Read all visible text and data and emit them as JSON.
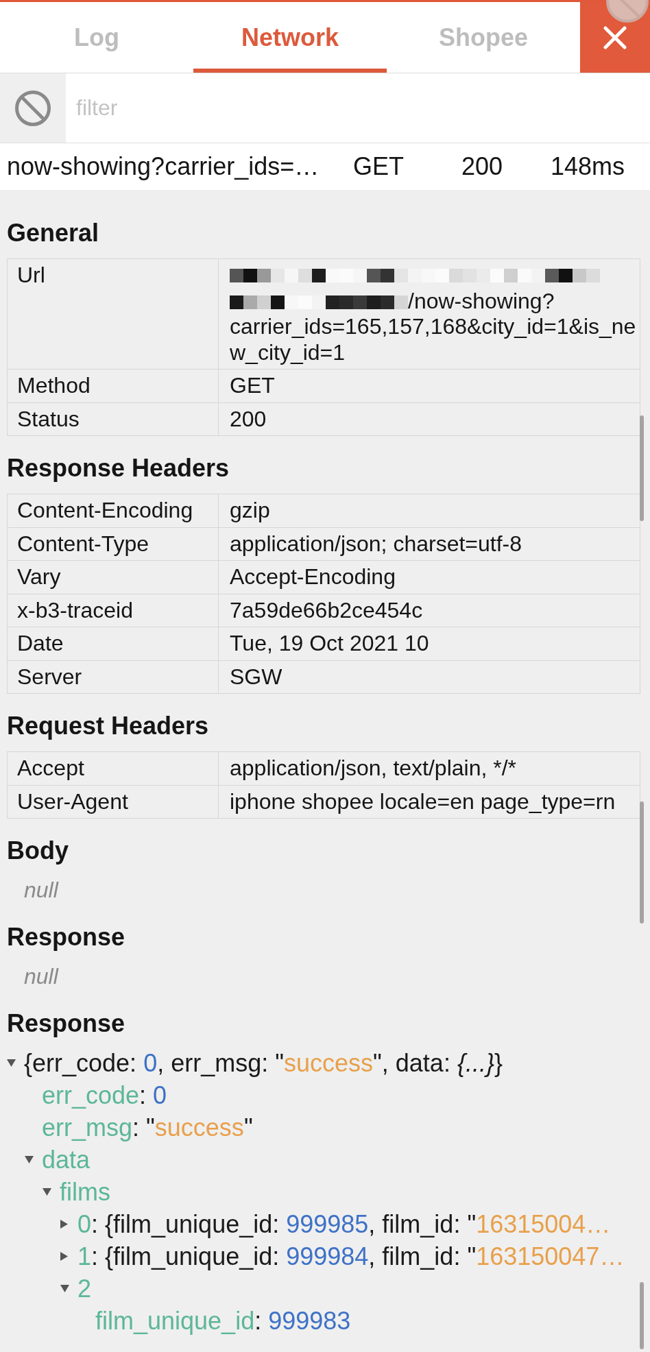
{
  "tabs": [
    {
      "label": "Log",
      "selected": false
    },
    {
      "label": "Network",
      "selected": true
    },
    {
      "label": "Shopee",
      "selected": false
    }
  ],
  "filter": {
    "placeholder": "filter"
  },
  "request": {
    "name": "now-showing?carrier_ids=…",
    "method": "GET",
    "status": "200",
    "time": "148ms"
  },
  "sections": [
    {
      "kind": "table",
      "title": "General",
      "rows": [
        {
          "name": "Url",
          "redacted": true,
          "visible_parts": [
            "/now-showing?",
            "carrier_ids=165,157,168&city_id=1&is_new_city_id=1"
          ]
        },
        {
          "name": "Method",
          "value": "GET",
          "redacted": false
        },
        {
          "name": "Status",
          "value": "200",
          "redacted": false
        }
      ]
    },
    {
      "kind": "table",
      "title": "Response Headers",
      "rows": [
        {
          "name": "Content-Encoding",
          "value": "gzip",
          "redacted": false
        },
        {
          "name": "Content-Type",
          "value": "application/json; charset=utf-8",
          "redacted": false
        },
        {
          "name": "Vary",
          "value": "Accept-Encoding",
          "redacted": false
        },
        {
          "name": "x-b3-traceid",
          "value": "7a59de66b2ce454c",
          "redacted": false
        },
        {
          "name": "Date",
          "value": "Tue, 19 Oct 2021 10",
          "redacted": false
        },
        {
          "name": "Server",
          "value": "SGW",
          "redacted": false
        }
      ]
    },
    {
      "kind": "table",
      "title": "Request Headers",
      "rows": [
        {
          "name": "Accept",
          "value": "application/json, text/plain, */*",
          "redacted": false
        },
        {
          "name": "User-Agent",
          "value": "iphone shopee locale=en page_type=rn",
          "redacted": false
        }
      ]
    },
    {
      "kind": "text",
      "title": "Body",
      "value": "null"
    },
    {
      "kind": "text",
      "title": "Response",
      "value": "null"
    },
    {
      "kind": "tree",
      "title": "Response",
      "nodes": [
        {
          "kind": "branch",
          "expanded": true,
          "parts": [
            {
              "kind": "punct",
              "text": "{err_code: "
            },
            {
              "kind": "number",
              "text": "0"
            },
            {
              "kind": "punct",
              "text": ", err_msg: \""
            },
            {
              "kind": "string",
              "text": "success"
            },
            {
              "kind": "punct",
              "text": "\", data: "
            },
            {
              "kind": "object",
              "text": "{...}"
            },
            {
              "kind": "punct",
              "text": "}"
            }
          ],
          "children": [
            {
              "kind": "leaf",
              "parts": [
                {
                  "kind": "key",
                  "text": "err_code"
                },
                {
                  "kind": "punct",
                  "text": ": "
                },
                {
                  "kind": "number",
                  "text": "0"
                }
              ]
            },
            {
              "kind": "leaf",
              "parts": [
                {
                  "kind": "key",
                  "text": "err_msg"
                },
                {
                  "kind": "punct",
                  "text": ": \""
                },
                {
                  "kind": "string",
                  "text": "success"
                },
                {
                  "kind": "punct",
                  "text": "\""
                }
              ]
            },
            {
              "kind": "branch",
              "expanded": true,
              "parts": [
                {
                  "kind": "key",
                  "text": "data"
                }
              ],
              "children": [
                {
                  "kind": "branch",
                  "expanded": true,
                  "parts": [
                    {
                      "kind": "key",
                      "text": "films"
                    }
                  ],
                  "children": [
                    {
                      "kind": "branch",
                      "expanded": false,
                      "parts": [
                        {
                          "kind": "key",
                          "text": "0"
                        },
                        {
                          "kind": "punct",
                          "text": ": {film_unique_id: "
                        },
                        {
                          "kind": "number",
                          "text": "999985"
                        },
                        {
                          "kind": "punct",
                          "text": ", film_id: \""
                        },
                        {
                          "kind": "string",
                          "text": "16315004…"
                        }
                      ]
                    },
                    {
                      "kind": "branch",
                      "expanded": false,
                      "parts": [
                        {
                          "kind": "key",
                          "text": "1"
                        },
                        {
                          "kind": "punct",
                          "text": ": {film_unique_id: "
                        },
                        {
                          "kind": "number",
                          "text": "999984"
                        },
                        {
                          "kind": "punct",
                          "text": ", film_id: \""
                        },
                        {
                          "kind": "string",
                          "text": "163150047…"
                        }
                      ]
                    },
                    {
                      "kind": "branch",
                      "expanded": true,
                      "parts": [
                        {
                          "kind": "key",
                          "text": "2"
                        }
                      ],
                      "children": [
                        {
                          "kind": "leaf",
                          "parts": [
                            {
                              "kind": "key",
                              "text": "film_unique_id"
                            },
                            {
                              "kind": "punct",
                              "text": ": "
                            },
                            {
                              "kind": "number",
                              "text": "999983"
                            }
                          ]
                        }
                      ]
                    }
                  ]
                }
              ]
            }
          ]
        }
      ]
    }
  ]
}
